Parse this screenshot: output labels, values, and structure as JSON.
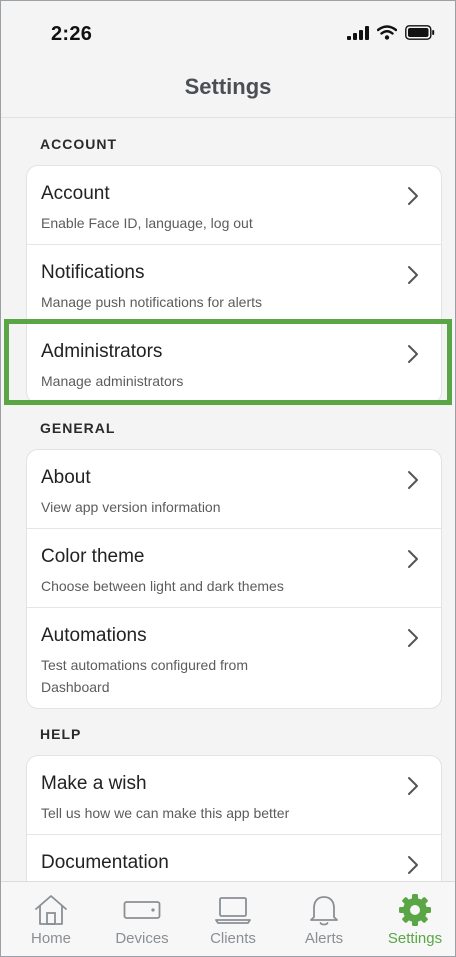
{
  "status_bar": {
    "time": "2:26",
    "icons": [
      "cellular-signal-icon",
      "wifi-icon",
      "battery-icon"
    ]
  },
  "header": {
    "title": "Settings"
  },
  "sections": [
    {
      "label": "ACCOUNT",
      "items": [
        {
          "title": "Account",
          "subtitle": "Enable Face ID, language, log out"
        },
        {
          "title": "Notifications",
          "subtitle": "Manage push notifications for alerts"
        },
        {
          "title": "Administrators",
          "subtitle": "Manage administrators"
        }
      ]
    },
    {
      "label": "GENERAL",
      "items": [
        {
          "title": "About",
          "subtitle": "View app version information"
        },
        {
          "title": "Color theme",
          "subtitle": "Choose between light and dark themes"
        },
        {
          "title": "Automations",
          "subtitle": "Test automations configured from Dashboard"
        }
      ]
    },
    {
      "label": "HELP",
      "items": [
        {
          "title": "Make a wish",
          "subtitle": "Tell us how we can make this app better"
        },
        {
          "title": "Documentation",
          "subtitle": ""
        }
      ]
    }
  ],
  "tab_bar": {
    "tabs": [
      {
        "label": "Home",
        "icon": "home-icon"
      },
      {
        "label": "Devices",
        "icon": "device-icon"
      },
      {
        "label": "Clients",
        "icon": "laptop-icon"
      },
      {
        "label": "Alerts",
        "icon": "bell-icon"
      },
      {
        "label": "Settings",
        "icon": "gear-icon"
      }
    ],
    "active_tab": "Settings"
  },
  "colors": {
    "accent": "#5aa646",
    "highlight_border": "#5aa646",
    "inactive_tab": "#8a8f94",
    "title_text": "#4a4f54"
  }
}
